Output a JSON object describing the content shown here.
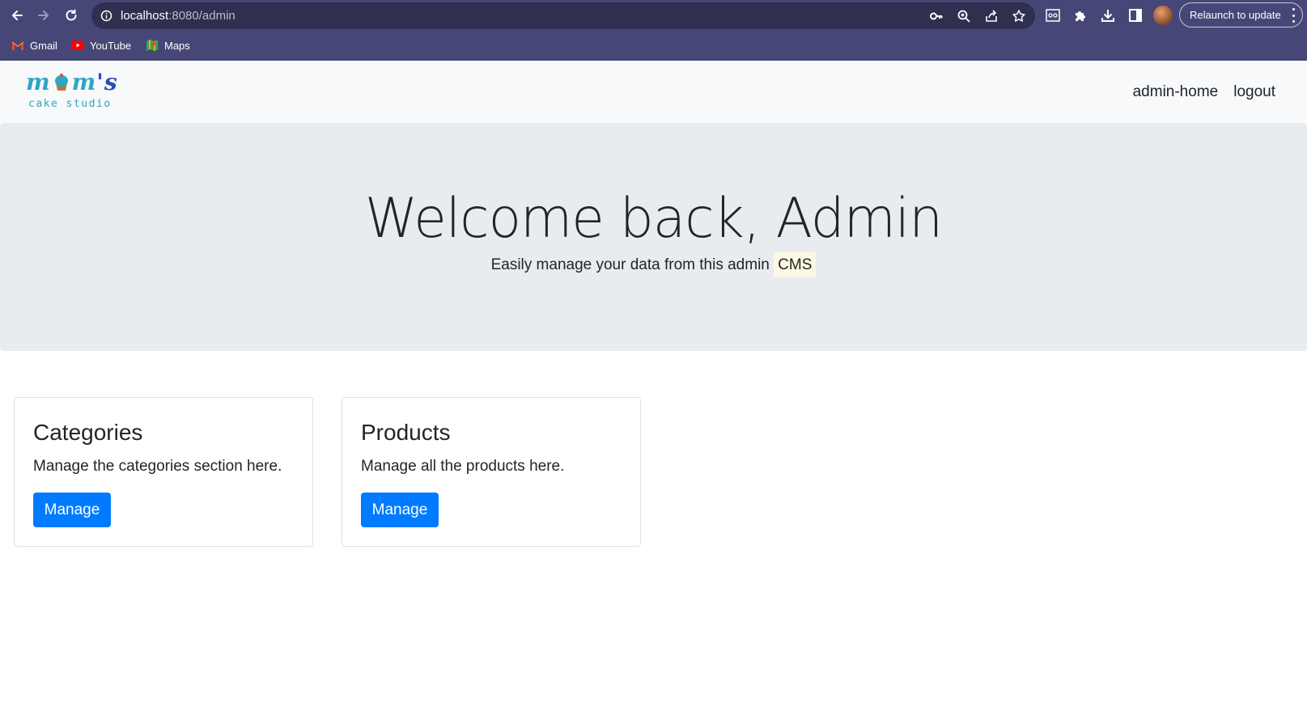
{
  "browser": {
    "url_host": "localhost",
    "url_path": ":8080/admin",
    "relaunch_label": "Relaunch to update",
    "bookmarks": [
      {
        "label": "Gmail",
        "icon": "gmail-icon"
      },
      {
        "label": "YouTube",
        "icon": "youtube-icon"
      },
      {
        "label": "Maps",
        "icon": "maps-icon"
      }
    ]
  },
  "navbar": {
    "logo_top": "m",
    "logo_top2": "m",
    "logo_apos": "'",
    "logo_s": "s",
    "logo_bottom": "cake studio",
    "links": [
      "admin-home",
      "logout"
    ]
  },
  "hero": {
    "title": "Welcome back, Admin",
    "subtitle": "Easily manage your data from this admin ",
    "subtitle_mark": "CMS"
  },
  "cards": [
    {
      "title": "Categories",
      "text": "Manage the categories section here.",
      "button": "Manage"
    },
    {
      "title": "Products",
      "text": "Manage all the products here.",
      "button": "Manage"
    }
  ],
  "colors": {
    "chrome": "#474777",
    "primary": "#007bff",
    "jumbotron": "#e9ecef",
    "navbar": "#f8f9fa"
  }
}
